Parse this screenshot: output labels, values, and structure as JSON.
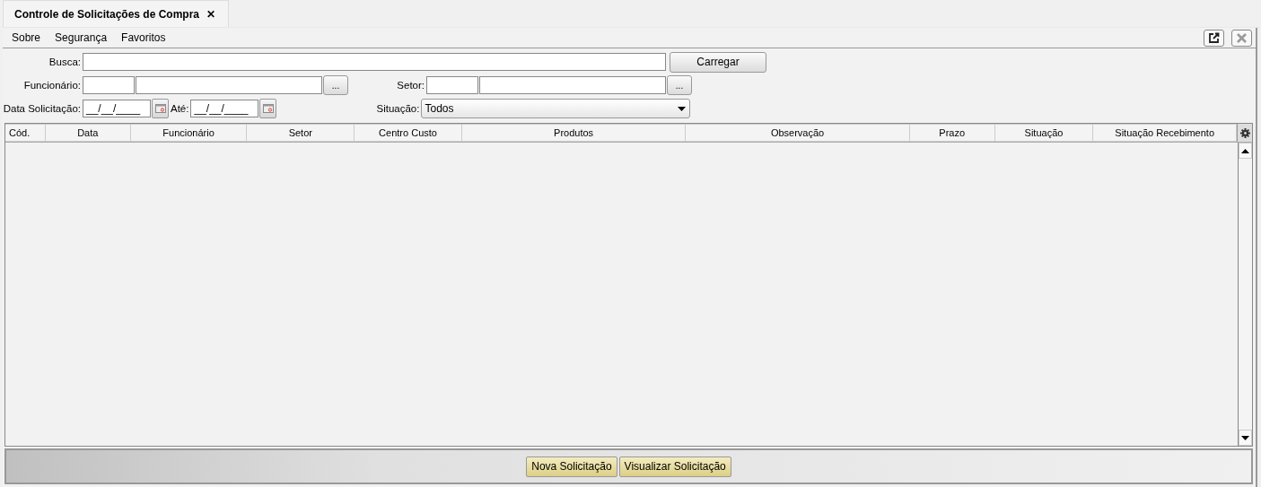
{
  "tab": {
    "title": "Controle de Solicitações de Compra",
    "close": "✕",
    "selected": true
  },
  "menu": [
    "Sobre",
    "Segurança",
    "Favoritos"
  ],
  "form": {
    "busca_label": "Busca:",
    "carregar": "Carregar",
    "funcionario_label": "Funcionário:",
    "setor_label": "Setor:",
    "browse": "...",
    "data_label": "Data Solicitação:",
    "data_value": "__/__/____",
    "ate_label": "Até:",
    "ate_value": "__/__/____",
    "situacao_label": "Situação:",
    "situacao_value": "Todos"
  },
  "table": {
    "columns": [
      "Cód.",
      "Data",
      "Funcionário",
      "Setor",
      "Centro Custo",
      "Produtos",
      "Observação",
      "Prazo",
      "Situação",
      "Situação Recebimento"
    ]
  },
  "buttons": [
    "Nova Solicitação",
    "Visualizar Solicitação"
  ]
}
